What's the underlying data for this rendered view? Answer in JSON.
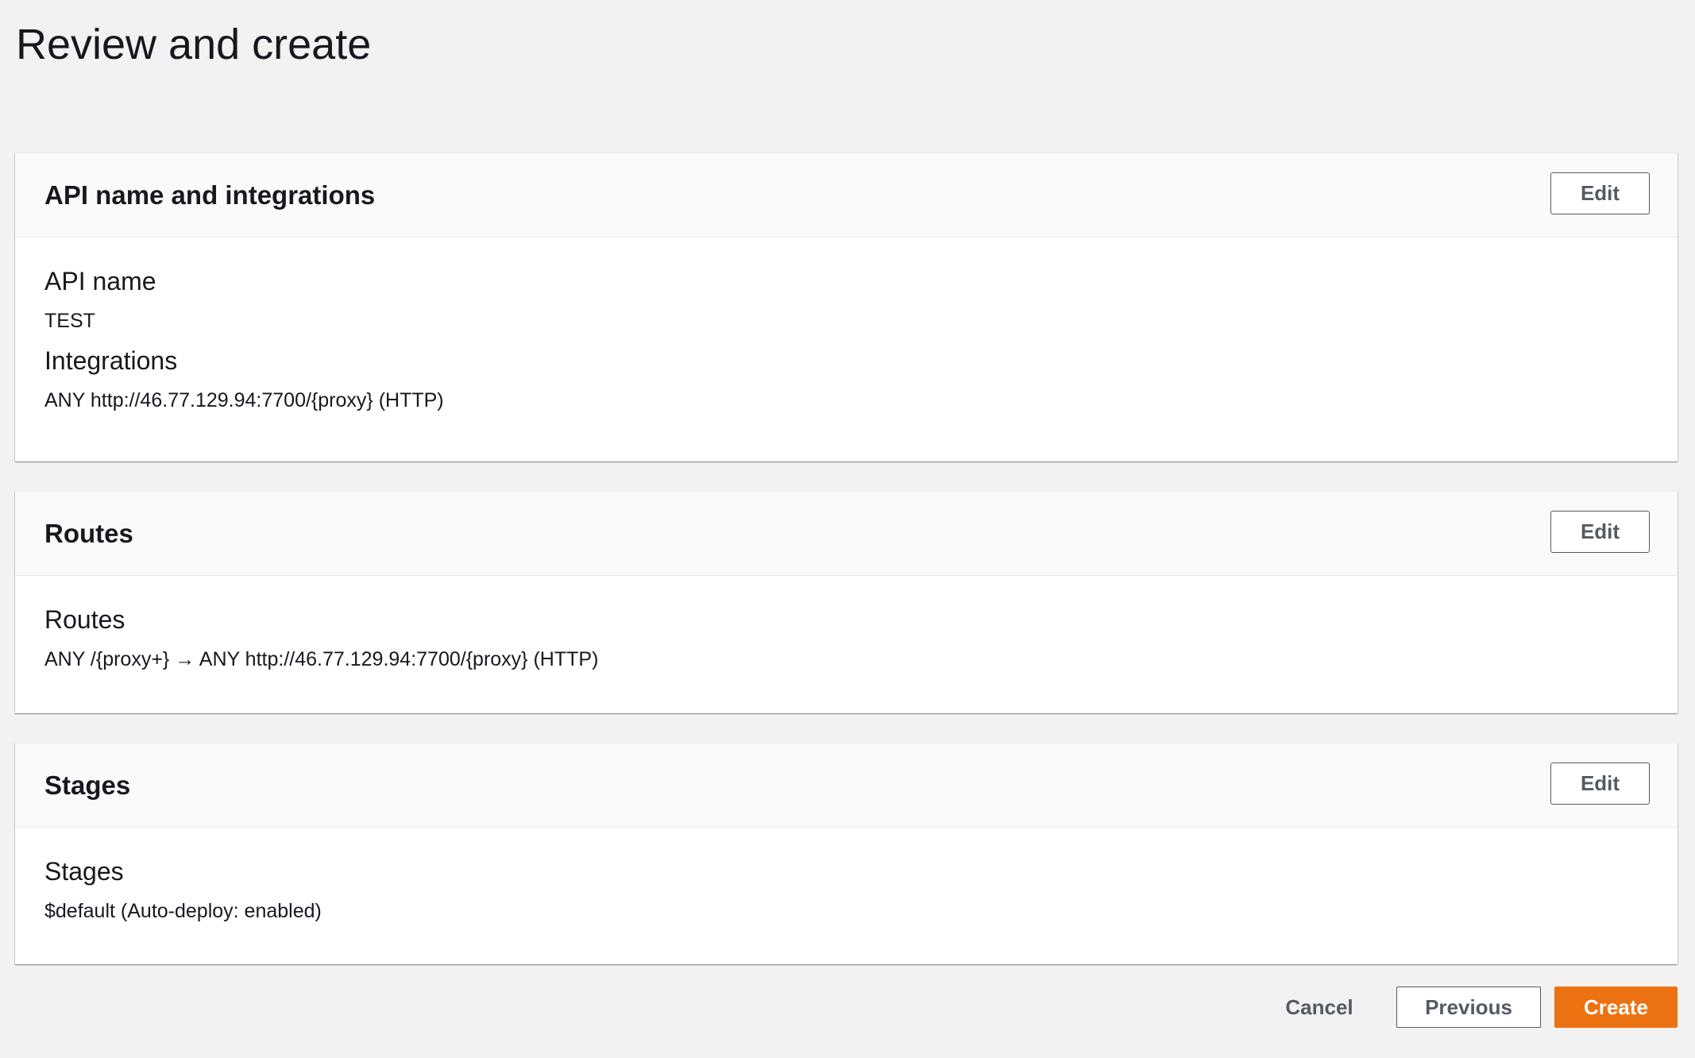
{
  "page": {
    "title": "Review and create"
  },
  "sections": [
    {
      "title": "API name and integrations",
      "edit_label": "Edit",
      "fields": [
        {
          "label": "API name",
          "value": "TEST"
        },
        {
          "label": "Integrations",
          "value": "ANY http://46.77.129.94:7700/{proxy} (HTTP)"
        }
      ]
    },
    {
      "title": "Routes",
      "edit_label": "Edit",
      "fields": [
        {
          "label": "Routes",
          "value": "ANY /{proxy+} → ANY http://46.77.129.94:7700/{proxy} (HTTP)"
        }
      ]
    },
    {
      "title": "Stages",
      "edit_label": "Edit",
      "fields": [
        {
          "label": "Stages",
          "value": "$default (Auto-deploy: enabled)"
        }
      ]
    }
  ],
  "footer": {
    "cancel_label": "Cancel",
    "previous_label": "Previous",
    "create_label": "Create"
  },
  "colors": {
    "primary_button": "#ec7211",
    "background": "#f2f2f2",
    "text": "#16191f",
    "secondary_text": "#545b64"
  }
}
